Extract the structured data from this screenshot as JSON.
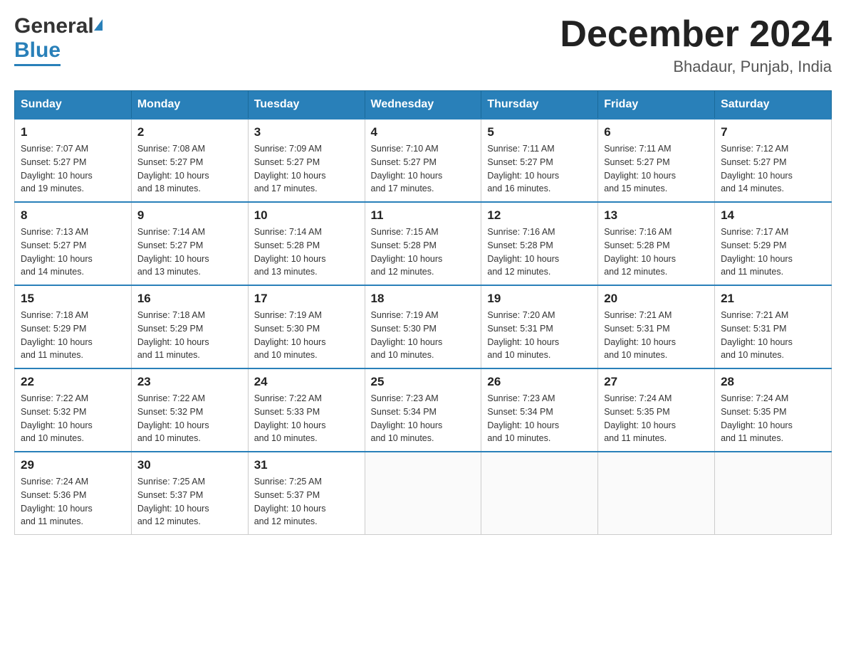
{
  "header": {
    "logo_general": "General",
    "logo_blue": "Blue",
    "month_title": "December 2024",
    "location": "Bhadaur, Punjab, India"
  },
  "days_of_week": [
    "Sunday",
    "Monday",
    "Tuesday",
    "Wednesday",
    "Thursday",
    "Friday",
    "Saturday"
  ],
  "weeks": [
    [
      {
        "num": "1",
        "sunrise": "7:07 AM",
        "sunset": "5:27 PM",
        "daylight": "10 hours and 19 minutes."
      },
      {
        "num": "2",
        "sunrise": "7:08 AM",
        "sunset": "5:27 PM",
        "daylight": "10 hours and 18 minutes."
      },
      {
        "num": "3",
        "sunrise": "7:09 AM",
        "sunset": "5:27 PM",
        "daylight": "10 hours and 17 minutes."
      },
      {
        "num": "4",
        "sunrise": "7:10 AM",
        "sunset": "5:27 PM",
        "daylight": "10 hours and 17 minutes."
      },
      {
        "num": "5",
        "sunrise": "7:11 AM",
        "sunset": "5:27 PM",
        "daylight": "10 hours and 16 minutes."
      },
      {
        "num": "6",
        "sunrise": "7:11 AM",
        "sunset": "5:27 PM",
        "daylight": "10 hours and 15 minutes."
      },
      {
        "num": "7",
        "sunrise": "7:12 AM",
        "sunset": "5:27 PM",
        "daylight": "10 hours and 14 minutes."
      }
    ],
    [
      {
        "num": "8",
        "sunrise": "7:13 AM",
        "sunset": "5:27 PM",
        "daylight": "10 hours and 14 minutes."
      },
      {
        "num": "9",
        "sunrise": "7:14 AM",
        "sunset": "5:27 PM",
        "daylight": "10 hours and 13 minutes."
      },
      {
        "num": "10",
        "sunrise": "7:14 AM",
        "sunset": "5:28 PM",
        "daylight": "10 hours and 13 minutes."
      },
      {
        "num": "11",
        "sunrise": "7:15 AM",
        "sunset": "5:28 PM",
        "daylight": "10 hours and 12 minutes."
      },
      {
        "num": "12",
        "sunrise": "7:16 AM",
        "sunset": "5:28 PM",
        "daylight": "10 hours and 12 minutes."
      },
      {
        "num": "13",
        "sunrise": "7:16 AM",
        "sunset": "5:28 PM",
        "daylight": "10 hours and 12 minutes."
      },
      {
        "num": "14",
        "sunrise": "7:17 AM",
        "sunset": "5:29 PM",
        "daylight": "10 hours and 11 minutes."
      }
    ],
    [
      {
        "num": "15",
        "sunrise": "7:18 AM",
        "sunset": "5:29 PM",
        "daylight": "10 hours and 11 minutes."
      },
      {
        "num": "16",
        "sunrise": "7:18 AM",
        "sunset": "5:29 PM",
        "daylight": "10 hours and 11 minutes."
      },
      {
        "num": "17",
        "sunrise": "7:19 AM",
        "sunset": "5:30 PM",
        "daylight": "10 hours and 10 minutes."
      },
      {
        "num": "18",
        "sunrise": "7:19 AM",
        "sunset": "5:30 PM",
        "daylight": "10 hours and 10 minutes."
      },
      {
        "num": "19",
        "sunrise": "7:20 AM",
        "sunset": "5:31 PM",
        "daylight": "10 hours and 10 minutes."
      },
      {
        "num": "20",
        "sunrise": "7:21 AM",
        "sunset": "5:31 PM",
        "daylight": "10 hours and 10 minutes."
      },
      {
        "num": "21",
        "sunrise": "7:21 AM",
        "sunset": "5:31 PM",
        "daylight": "10 hours and 10 minutes."
      }
    ],
    [
      {
        "num": "22",
        "sunrise": "7:22 AM",
        "sunset": "5:32 PM",
        "daylight": "10 hours and 10 minutes."
      },
      {
        "num": "23",
        "sunrise": "7:22 AM",
        "sunset": "5:32 PM",
        "daylight": "10 hours and 10 minutes."
      },
      {
        "num": "24",
        "sunrise": "7:22 AM",
        "sunset": "5:33 PM",
        "daylight": "10 hours and 10 minutes."
      },
      {
        "num": "25",
        "sunrise": "7:23 AM",
        "sunset": "5:34 PM",
        "daylight": "10 hours and 10 minutes."
      },
      {
        "num": "26",
        "sunrise": "7:23 AM",
        "sunset": "5:34 PM",
        "daylight": "10 hours and 10 minutes."
      },
      {
        "num": "27",
        "sunrise": "7:24 AM",
        "sunset": "5:35 PM",
        "daylight": "10 hours and 11 minutes."
      },
      {
        "num": "28",
        "sunrise": "7:24 AM",
        "sunset": "5:35 PM",
        "daylight": "10 hours and 11 minutes."
      }
    ],
    [
      {
        "num": "29",
        "sunrise": "7:24 AM",
        "sunset": "5:36 PM",
        "daylight": "10 hours and 11 minutes."
      },
      {
        "num": "30",
        "sunrise": "7:25 AM",
        "sunset": "5:37 PM",
        "daylight": "10 hours and 12 minutes."
      },
      {
        "num": "31",
        "sunrise": "7:25 AM",
        "sunset": "5:37 PM",
        "daylight": "10 hours and 12 minutes."
      },
      null,
      null,
      null,
      null
    ]
  ],
  "labels": {
    "sunrise": "Sunrise:",
    "sunset": "Sunset:",
    "daylight": "Daylight:"
  }
}
